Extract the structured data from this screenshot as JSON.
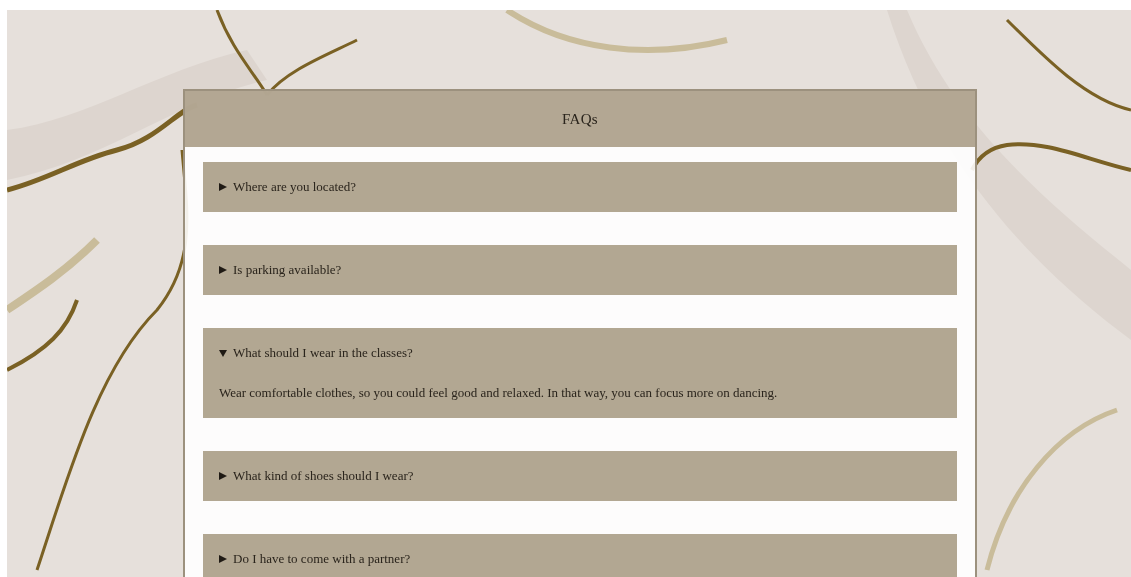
{
  "header": {
    "title": "FAQs"
  },
  "faqs": [
    {
      "question": "Where are you located?",
      "expanded": false
    },
    {
      "question": "Is parking available?",
      "expanded": false
    },
    {
      "question": "What should I wear in the classes?",
      "expanded": true,
      "answer": "Wear comfortable clothes, so you could feel good and relaxed. In that way, you can focus more on dancing."
    },
    {
      "question": "What kind of shoes should I wear?",
      "expanded": false
    },
    {
      "question": "Do I have to come with a partner?",
      "expanded": false
    }
  ]
}
